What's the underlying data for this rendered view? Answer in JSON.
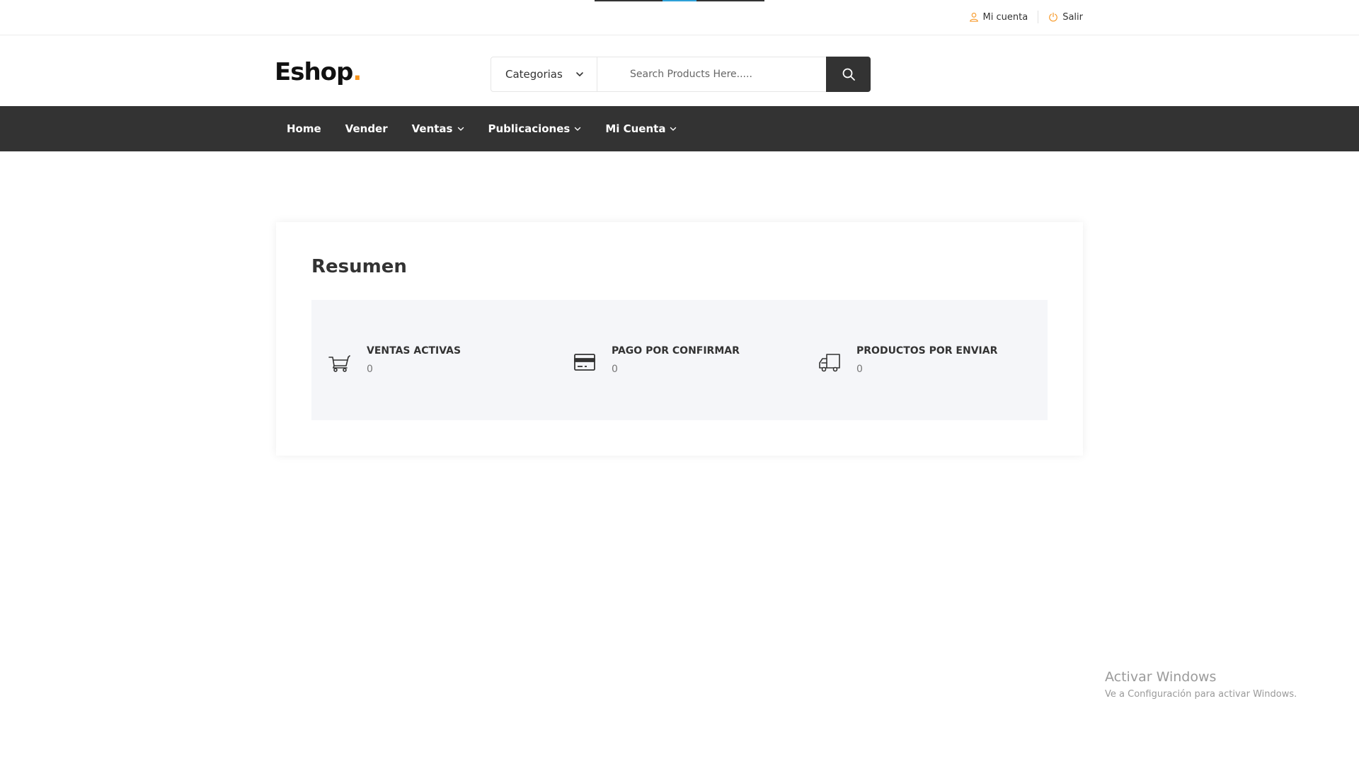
{
  "topbar": {
    "account_label": "Mi cuenta",
    "logout_label": "Salir"
  },
  "header": {
    "logo_text": "Eshop",
    "logo_dot": ".",
    "category_select": "Categorias",
    "search_placeholder": "Search Products Here....."
  },
  "nav": {
    "items": [
      {
        "label": "Home",
        "dropdown": false
      },
      {
        "label": "Vender",
        "dropdown": false
      },
      {
        "label": "Ventas",
        "dropdown": true
      },
      {
        "label": "Publicaciones",
        "dropdown": true
      },
      {
        "label": "Mi Cuenta",
        "dropdown": true
      }
    ]
  },
  "summary": {
    "title": "Resumen",
    "stats": [
      {
        "label": "VENTAS ACTIVAS",
        "value": "0",
        "icon": "cart-icon"
      },
      {
        "label": "PAGO POR CONFIRMAR",
        "value": "0",
        "icon": "credit-card-icon"
      },
      {
        "label": "PRODUCTOS POR ENVIAR",
        "value": "0",
        "icon": "truck-icon"
      }
    ]
  },
  "watermark": {
    "line1": "Activar Windows",
    "line2": "Ve a Configuración para activar Windows."
  },
  "colors": {
    "accent": "#f7941d",
    "nav_bg": "#333333",
    "summary_bg": "#f5f6f9",
    "loader": "#2ea1d8"
  }
}
